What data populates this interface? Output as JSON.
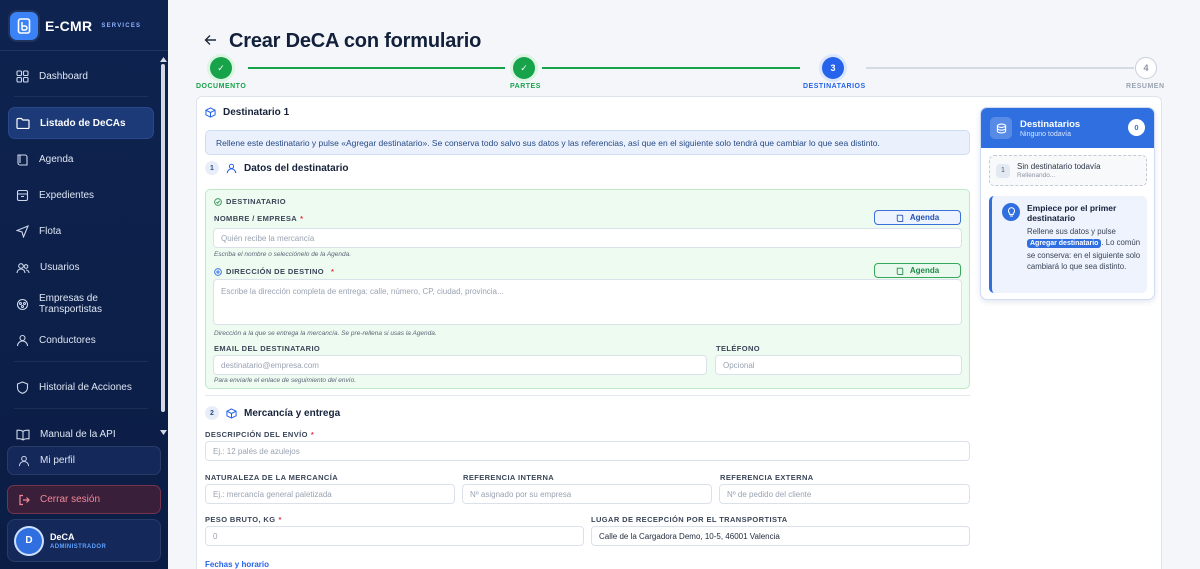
{
  "brand": {
    "name": "E-CMR",
    "sub": "SERVICES"
  },
  "sidebar": {
    "items": [
      {
        "label": "Dashboard",
        "icon": "grid-icon"
      },
      {
        "label": "Listado de DeCAs",
        "icon": "folder-icon",
        "active": true
      },
      {
        "label": "Agenda",
        "icon": "book-icon"
      },
      {
        "label": "Expedientes",
        "icon": "archive-icon"
      },
      {
        "label": "Flota",
        "icon": "send-icon"
      },
      {
        "label": "Usuarios",
        "icon": "users-icon"
      },
      {
        "label_line1": "Empresas de",
        "label_line2": "Transportistas",
        "icon": "building-icon"
      },
      {
        "label": "Conductores",
        "icon": "user-icon"
      },
      {
        "label": "Historial de Acciones",
        "icon": "shield-icon"
      },
      {
        "label": "Manual de la API",
        "icon": "book-open-icon"
      }
    ],
    "profile_label": "Mi perfil",
    "logout_label": "Cerrar sesión",
    "user": {
      "initial": "D",
      "name": "DeCA",
      "role": "ADMINISTRADOR"
    }
  },
  "page": {
    "title": "Crear DeCA con formulario"
  },
  "stepper": {
    "steps": [
      {
        "label": "DOCUMENTO",
        "state": "done",
        "marker": "✓"
      },
      {
        "label": "PARTES",
        "state": "done",
        "marker": "✓"
      },
      {
        "label": "DESTINATARIOS",
        "state": "current",
        "marker": "3"
      },
      {
        "label": "RESUMEN",
        "state": "todo",
        "marker": "4"
      }
    ]
  },
  "form": {
    "card_title": "Destinatario 1",
    "info": "Rellene este destinatario y pulse «Agregar destinatario». Se conserva todo salvo sus datos y las referencias, así que en el siguiente solo tendrá que cambiar lo que sea distinto.",
    "section1": {
      "num": "1",
      "title": "Datos del destinatario"
    },
    "recipient": {
      "group_label": "DESTINATARIO",
      "name_label": "NOMBRE / EMPRESA",
      "name_placeholder": "Quién recibe la mercancía",
      "name_hint": "Escriba el nombre o selecciónelo de la Agenda.",
      "agenda_label": "Agenda",
      "address_label": "DIRECCIÓN DE DESTINO",
      "address_placeholder": "Escribe la dirección completa de entrega: calle, número, CP, ciudad, provincia...",
      "address_hint": "Dirección a la que se entrega la mercancía. Se pre-rellena si usas la Agenda.",
      "agenda2_label": "Agenda",
      "email_label": "EMAIL DEL DESTINATARIO",
      "email_placeholder": "destinatario@empresa.com",
      "email_hint": "Para enviarle el enlace de seguimiento del envío.",
      "phone_label": "TELÉFONO",
      "phone_placeholder": "Opcional"
    },
    "section2": {
      "num": "2",
      "title": "Mercancía y entrega"
    },
    "goods": {
      "desc_label": "DESCRIPCIÓN DEL ENVÍO",
      "desc_placeholder": "Ej.: 12 palés de azulejos",
      "nature_label": "NATURALEZA DE LA MERCANCÍA",
      "nature_placeholder": "Ej.: mercancía general paletizada",
      "ref_int_label": "REFERENCIA INTERNA",
      "ref_int_placeholder": "Nº asignado por su empresa",
      "ref_ext_label": "REFERENCIA EXTERNA",
      "ref_ext_placeholder": "Nº de pedido del cliente",
      "weight_label": "PESO BRUTO, KG",
      "weight_placeholder": "0",
      "pickup_label": "LUGAR DE RECEPCIÓN POR EL TRANSPORTISTA",
      "pickup_value": "Calle de la Cargadora Demo, 10-5, 46001 Valencia",
      "dates_link": "Fechas y horario"
    }
  },
  "panel": {
    "title": "Destinatarios",
    "subtitle": "Ninguno todavía",
    "count": "0",
    "empty_num": "1",
    "empty_title": "Sin destinatario todavía",
    "empty_sub": "Rellenando...",
    "tip_title": "Empiece por el primer destinatario",
    "tip_body_1": "Rellene sus datos y pulse",
    "tip_pill": "Agregar destinatario",
    "tip_body_2": ". Lo común se conserva: en el siguiente solo cambiará lo que sea distinto."
  },
  "colors": {
    "sidebar_bg": "#0e2350",
    "accent": "#2563eb",
    "success": "#16a34a",
    "danger": "#e0344a"
  }
}
